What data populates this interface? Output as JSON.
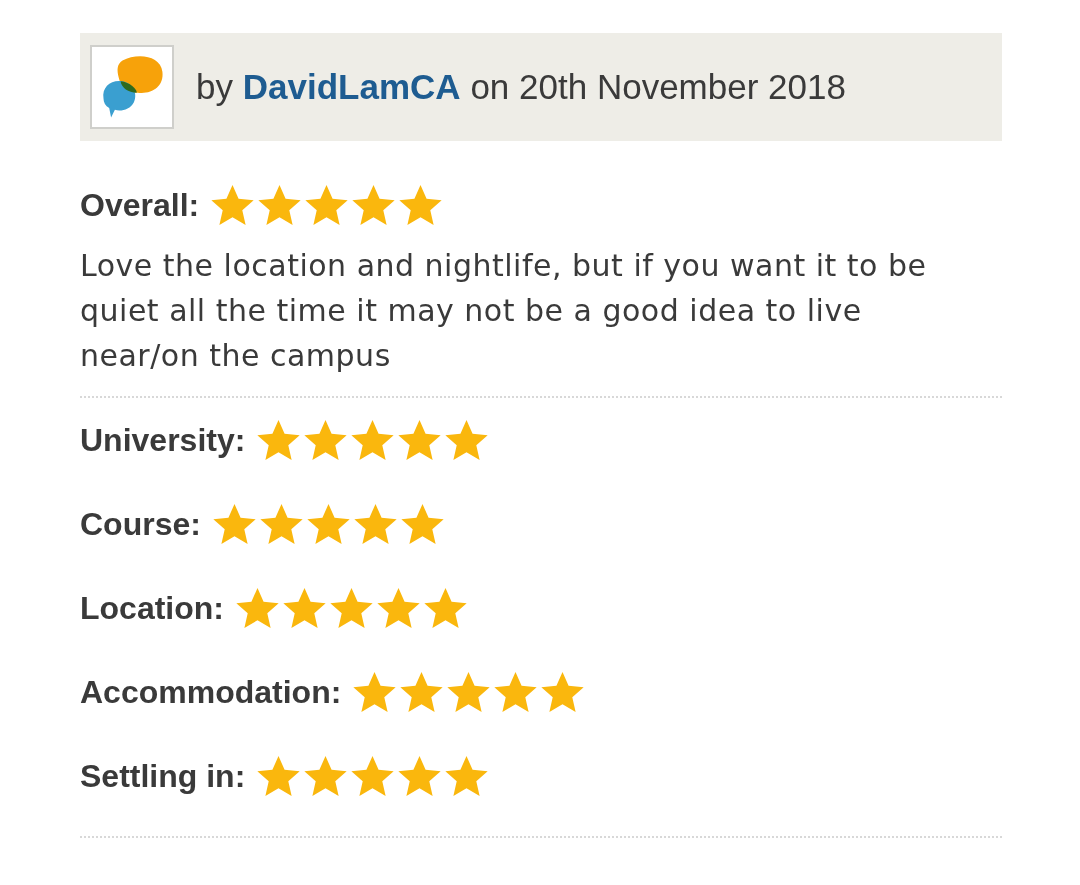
{
  "review": {
    "by_prefix": "by",
    "author": "DavidLamCA",
    "date_text": "on 20th November 2018",
    "overall": {
      "label": "Overall:",
      "stars": 5
    },
    "comment": "Love the location and nightlife, but if you want it to be quiet all the time it may not be a good idea to live near/on the campus",
    "ratings": [
      {
        "label": "University:",
        "stars": 5
      },
      {
        "label": "Course:",
        "stars": 5
      },
      {
        "label": "Location:",
        "stars": 5
      },
      {
        "label": "Accommodation:",
        "stars": 5
      },
      {
        "label": "Settling in:",
        "stars": 5
      }
    ]
  }
}
